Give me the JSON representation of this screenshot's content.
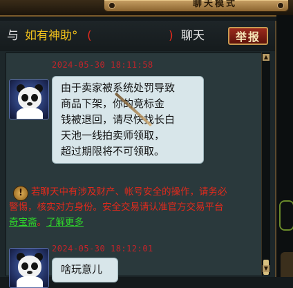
{
  "window": {
    "title": "聊天模式"
  },
  "header": {
    "prefix": "与",
    "name": "如有神助°",
    "paren_open": "(",
    "paren_close": ")",
    "suffix": "聊天",
    "report_label": "举报"
  },
  "messages": [
    {
      "timestamp": "2024-05-30 18:11:58",
      "lines": [
        "由于卖家被系统处罚导致",
        "商品下架，你的竞标金",
        "钱被退回，请尽快找长白",
        "天池一线拍卖师领取，",
        "超过期限将不可领取。"
      ]
    },
    {
      "timestamp": "2024-05-30 18:12:01",
      "lines": [
        "啥玩意儿"
      ]
    }
  ],
  "warning": {
    "icon": "warning-shield-icon",
    "line1": "若聊天中有涉及财产、帐号安全的操作，请务必",
    "line2": "警惕，核实对方身份。安全交易请认准官方交易平台",
    "link1": "奇宝斋",
    "sep": "。",
    "link2": "了解更多"
  },
  "colors": {
    "timestamp": "#c4242a",
    "warning": "#e32a1c",
    "link": "#2fd82a",
    "name": "#f2c21c",
    "paren": "#e32a1c"
  },
  "scrollbar": {
    "up": "▲",
    "down": "▼"
  }
}
